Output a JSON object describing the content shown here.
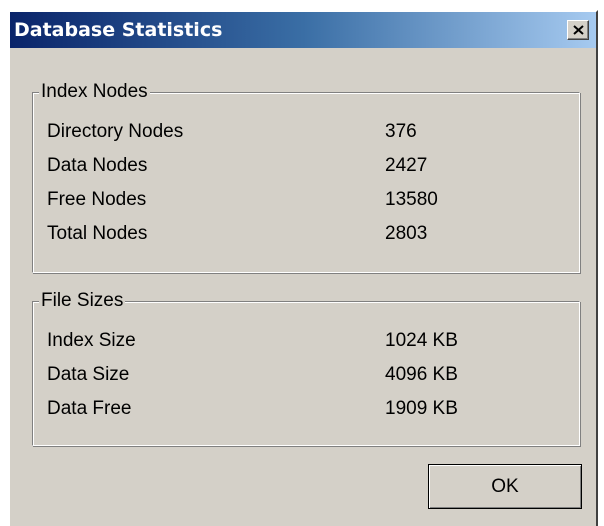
{
  "window": {
    "title": "Database Statistics",
    "close_icon": "close-icon"
  },
  "index_nodes": {
    "legend": "Index Nodes",
    "rows": [
      {
        "label": "Directory Nodes",
        "value": "376"
      },
      {
        "label": "Data Nodes",
        "value": "2427"
      },
      {
        "label": "Free Nodes",
        "value": "13580"
      },
      {
        "label": "Total Nodes",
        "value": "2803"
      }
    ]
  },
  "file_sizes": {
    "legend": "File Sizes",
    "rows": [
      {
        "label": "Index Size",
        "value": "1024 KB"
      },
      {
        "label": "Data Size",
        "value": "4096 KB"
      },
      {
        "label": "Data Free",
        "value": "1909 KB"
      }
    ]
  },
  "buttons": {
    "ok_label": "OK"
  },
  "colors": {
    "titlebar_start": "#0a246a",
    "titlebar_end": "#a6caf0",
    "dialog_face": "#d4d0c8"
  }
}
